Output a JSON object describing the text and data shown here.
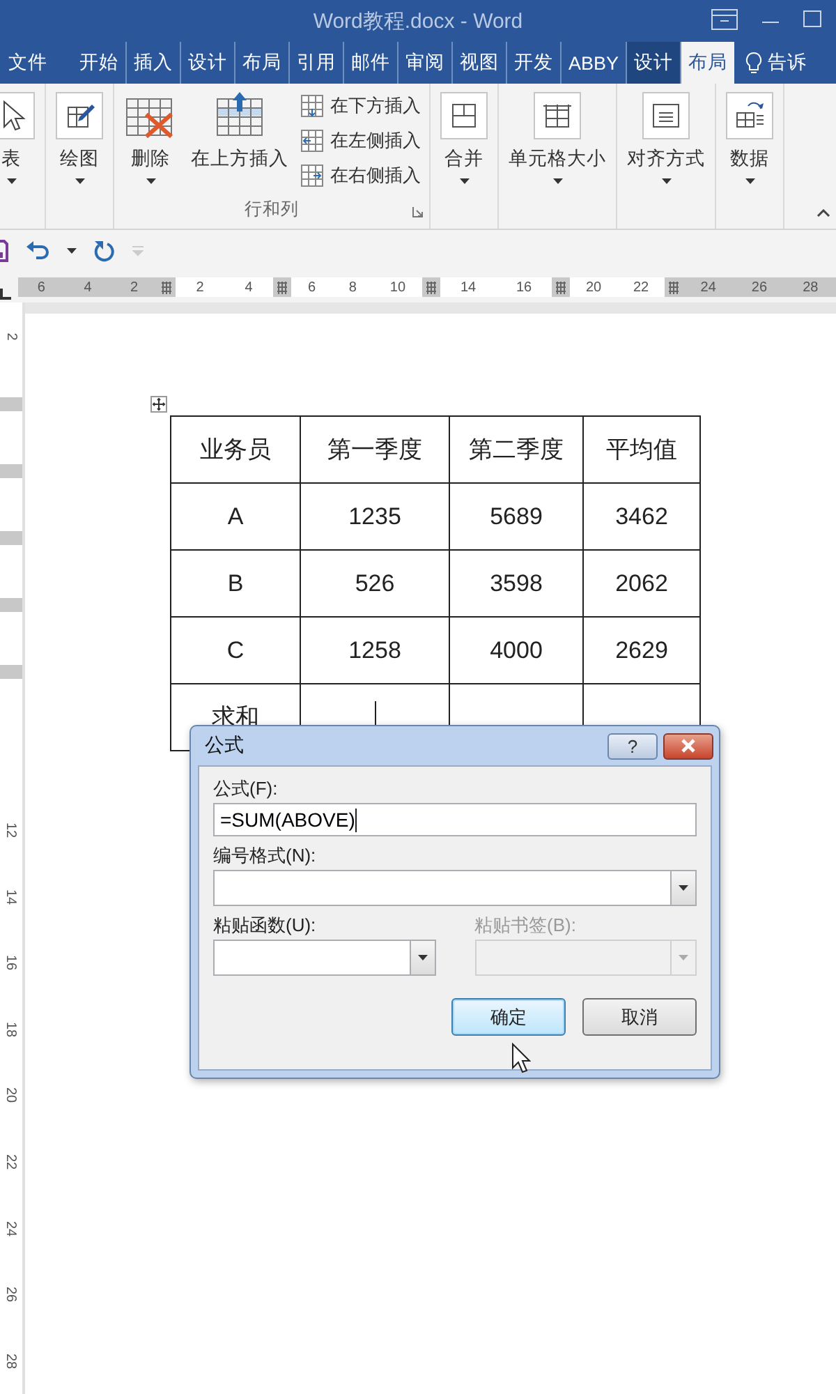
{
  "window": {
    "title": "Word教程.docx - Word"
  },
  "tabs": [
    {
      "label": "文件",
      "kind": "file",
      "selected": false
    },
    {
      "label": "开始",
      "kind": "normal",
      "selected": false
    },
    {
      "label": "插入",
      "kind": "normal",
      "selected": false
    },
    {
      "label": "设计",
      "kind": "normal",
      "selected": false
    },
    {
      "label": "布局",
      "kind": "normal",
      "selected": false
    },
    {
      "label": "引用",
      "kind": "normal",
      "selected": false
    },
    {
      "label": "邮件",
      "kind": "normal",
      "selected": false
    },
    {
      "label": "审阅",
      "kind": "normal",
      "selected": false
    },
    {
      "label": "视图",
      "kind": "normal",
      "selected": false
    },
    {
      "label": "开发",
      "kind": "normal",
      "selected": false
    },
    {
      "label": "ABBY",
      "kind": "normal",
      "selected": false
    },
    {
      "label": "设计",
      "kind": "contextual",
      "selected": false
    },
    {
      "label": "布局",
      "kind": "contextual",
      "selected": true
    }
  ],
  "tell_me": {
    "text": "告诉"
  },
  "ribbon": {
    "groups": [
      {
        "buttons": [
          {
            "kind": "large",
            "label": "表",
            "dropdown": true
          }
        ]
      },
      {
        "buttons": [
          {
            "kind": "large",
            "label": "绘图",
            "dropdown": true
          }
        ]
      },
      {
        "label": "行和列",
        "buttons": [
          {
            "kind": "large",
            "label": "删除",
            "dropdown": true
          },
          {
            "kind": "large",
            "label": "在上方插入",
            "dropdown": false
          },
          {
            "kind": "small",
            "label": "在下方插入"
          },
          {
            "kind": "small",
            "label": "在左侧插入"
          },
          {
            "kind": "small",
            "label": "在右侧插入"
          }
        ]
      },
      {
        "buttons": [
          {
            "kind": "large",
            "label": "合并",
            "dropdown": true
          }
        ]
      },
      {
        "buttons": [
          {
            "kind": "large",
            "label": "单元格大小",
            "dropdown": true
          }
        ]
      },
      {
        "buttons": [
          {
            "kind": "large",
            "label": "对齐方式",
            "dropdown": true
          }
        ]
      },
      {
        "buttons": [
          {
            "kind": "large",
            "label": "数据",
            "dropdown": true
          }
        ]
      }
    ]
  },
  "ruler": {
    "segments": [
      {
        "kind": "margin",
        "labels": [
          "6",
          "4",
          "2"
        ]
      },
      {
        "kind": "cell",
        "labels": [
          "2",
          "4"
        ]
      },
      {
        "kind": "cell",
        "labels": [
          "6",
          "8",
          "10"
        ]
      },
      {
        "kind": "cell",
        "labels": [
          "14",
          "16"
        ]
      },
      {
        "kind": "cell",
        "labels": [
          "20",
          "22"
        ]
      },
      {
        "kind": "margin",
        "labels": [
          "24",
          "26",
          "28"
        ]
      }
    ]
  },
  "vertical_ruler": {
    "labels": [
      "2",
      "12",
      "14",
      "16",
      "18",
      "20",
      "22",
      "24",
      "26",
      "28"
    ]
  },
  "table": {
    "columns": [
      "业务员",
      "第一季度",
      "第二季度",
      "平均值"
    ],
    "rows": [
      {
        "cells": [
          "A",
          "1235",
          "5689",
          "3462"
        ],
        "text_cursor": false
      },
      {
        "cells": [
          "B",
          "526",
          "3598",
          "2062"
        ],
        "text_cursor": false
      },
      {
        "cells": [
          "C",
          "1258",
          "4000",
          "2629"
        ],
        "text_cursor": false
      },
      {
        "cells": [
          "求和"
        ],
        "text_cursor": true
      }
    ]
  },
  "dialog": {
    "title": "公式",
    "help": "?",
    "formula": {
      "label": "公式(F):",
      "value": "=SUM(ABOVE)"
    },
    "number_format": {
      "label": "编号格式(N):"
    },
    "combos": [
      {
        "label": "粘贴函数(U):",
        "disabled": false
      },
      {
        "label": "粘贴书签(B):",
        "disabled": true
      }
    ],
    "buttons": [
      {
        "label": "确定",
        "default": true
      },
      {
        "label": "取消",
        "default": false
      }
    ]
  }
}
